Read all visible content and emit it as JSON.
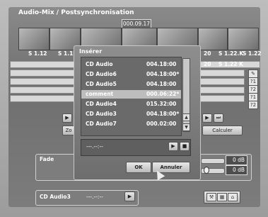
{
  "window": {
    "title": "Audio-Mix / Postsynchronisation",
    "timecode": "000.09.17"
  },
  "timeline": {
    "thumb_labels": [
      "S 1.12",
      "S 1.1",
      "20",
      "S 1.22.K",
      "S 1.22"
    ],
    "right_labels": [
      "20",
      "S 1.22 K"
    ]
  },
  "tracks": {
    "labels_right": [
      "?1",
      "?2",
      "?1",
      "?2"
    ]
  },
  "buttons": {
    "zoom_partial": "Zo",
    "calculate": "Calculer"
  },
  "fade": {
    "label": "Fade",
    "db1": "0 dB",
    "db2": "0 dB"
  },
  "bottom": {
    "track_name": "CD Audio3",
    "time_placeholder": "---.--:--"
  },
  "dialog": {
    "title": "Insérer",
    "items": [
      {
        "name": "CD Audio",
        "time": "004.18:00"
      },
      {
        "name": "CD Audio6",
        "time": "004.18:00*"
      },
      {
        "name": "CD Audio5",
        "time": "004.18:00"
      },
      {
        "name": "comment",
        "time": "000.06:22*"
      },
      {
        "name": "CD Audio4",
        "time": "015.32:00"
      },
      {
        "name": "CD Audio3",
        "time": "004.18:00*"
      },
      {
        "name": "CD Audio7",
        "time": "000.02:00"
      }
    ],
    "player_time": "---.--:--",
    "ok": "OK",
    "cancel": "Annuler"
  }
}
